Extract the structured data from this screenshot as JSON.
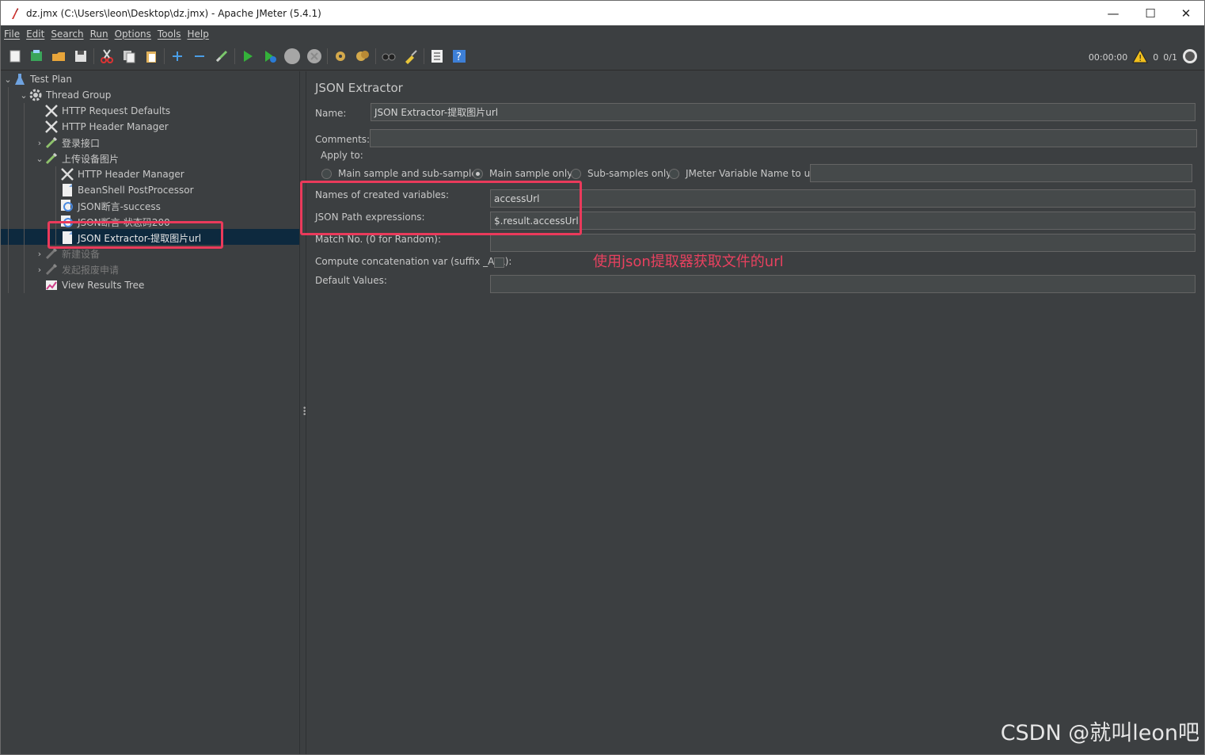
{
  "window": {
    "title": "dz.jmx (C:\\Users\\leon\\Desktop\\dz.jmx) - Apache JMeter (5.4.1)",
    "controls": {
      "minimize": "—",
      "maximize": "☐",
      "close": "✕"
    }
  },
  "menu": [
    "File",
    "Edit",
    "Search",
    "Run",
    "Options",
    "Tools",
    "Help"
  ],
  "toolbar": {
    "icons": [
      "new-icon",
      "templates-icon",
      "open-icon",
      "save-icon",
      "cut-icon",
      "copy-icon",
      "paste-icon",
      "expand-icon",
      "collapse-icon",
      "toggle-icon",
      "start-icon",
      "start-no-pause-icon",
      "stop-icon",
      "shutdown-icon",
      "clear-icon",
      "clear-all-icon",
      "search-icon",
      "reset-search-icon",
      "function-helper-icon",
      "help-icon"
    ],
    "timer": "00:00:00",
    "warnings": "0",
    "threads": "0/1"
  },
  "tree": [
    {
      "label": "Test Plan",
      "icon": "test-plan-icon",
      "arrow": "expanded"
    },
    {
      "label": "Thread Group",
      "icon": "gear-icon",
      "arrow": "expanded"
    },
    {
      "label": "HTTP Request Defaults",
      "icon": "wrench-icon",
      "arrow": ""
    },
    {
      "label": "HTTP Header Manager",
      "icon": "wrench-icon",
      "arrow": ""
    },
    {
      "label": "登录接口",
      "icon": "pipette-icon",
      "arrow": "collapsed"
    },
    {
      "label": "上传设备图片",
      "icon": "pipette-icon",
      "arrow": "expanded"
    },
    {
      "label": "HTTP Header Manager",
      "icon": "wrench-icon",
      "arrow": ""
    },
    {
      "label": "BeanShell PostProcessor",
      "icon": "document-icon",
      "arrow": ""
    },
    {
      "label": "JSON断言-success",
      "icon": "magnifier-icon",
      "arrow": ""
    },
    {
      "label": "JSON断言-状态码200",
      "icon": "magnifier-icon",
      "arrow": ""
    },
    {
      "label": "JSON Extractor-提取图片url",
      "icon": "document-icon",
      "arrow": "",
      "selected": true
    },
    {
      "label": "新建设备",
      "icon": "pipette-icon",
      "arrow": "collapsed",
      "disabled": true
    },
    {
      "label": "发起报废申请",
      "icon": "pipette-icon",
      "arrow": "collapsed",
      "disabled": true
    },
    {
      "label": "View Results Tree",
      "icon": "chart-icon",
      "arrow": ""
    }
  ],
  "panel": {
    "title": "JSON Extractor",
    "name_label": "Name:",
    "name_value": "JSON Extractor-提取图片url",
    "comments_label": "Comments:",
    "comments_value": "",
    "apply_to_label": "Apply to:",
    "apply_options": [
      {
        "label": "Main sample and sub-samples",
        "checked": false
      },
      {
        "label": "Main sample only",
        "checked": true
      },
      {
        "label": "Sub-samples only",
        "checked": false
      },
      {
        "label": "JMeter Variable Name to use",
        "checked": false
      }
    ],
    "var_name_value": "",
    "names_label": "Names of created variables:",
    "names_value": "accessUrl",
    "paths_label": "JSON Path expressions:",
    "paths_value": "$.result.accessUrl",
    "match_label": "Match No. (0 for Random):",
    "match_value": "",
    "concat_label": "Compute concatenation var (suffix _ALL):",
    "default_label": "Default Values:",
    "default_value": ""
  },
  "annotation": "使用json提取器获取文件的url",
  "watermark": "CSDN @就叫leon吧",
  "colors": {
    "accent_red": "#ea3a5b",
    "selection": "#0d293e",
    "background": "#3c3f41"
  }
}
